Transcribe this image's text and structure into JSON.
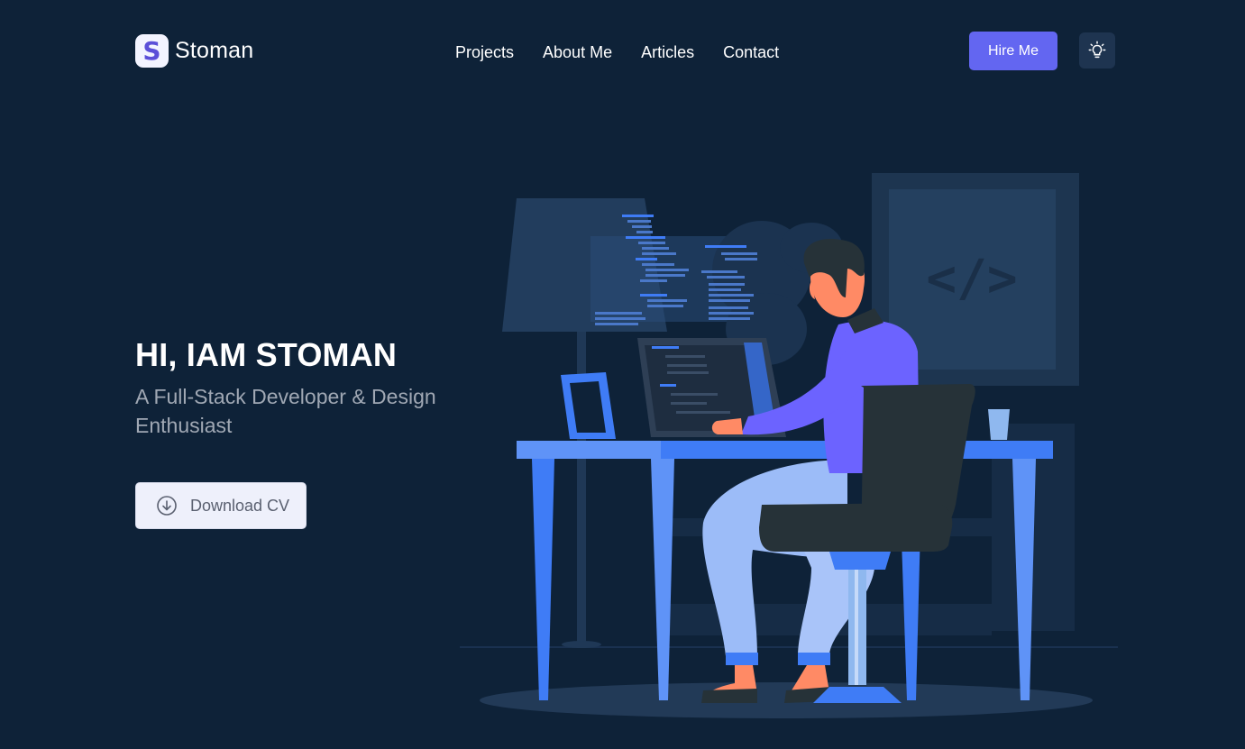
{
  "brand": {
    "logo_letter": "S",
    "name": "Stoman"
  },
  "nav": {
    "items": [
      {
        "label": "Projects"
      },
      {
        "label": "About Me"
      },
      {
        "label": "Articles"
      },
      {
        "label": "Contact"
      }
    ]
  },
  "header": {
    "hire_label": "Hire Me",
    "theme_icon": "lightbulb-icon"
  },
  "hero": {
    "title": "HI, IAM STOMAN",
    "subtitle": "A Full-Stack Developer & Design Enthusiast",
    "cv_label": "Download CV",
    "cv_icon": "download-icon"
  },
  "illustration": {
    "code_sign": "</>"
  },
  "colors": {
    "background": "#0e2238",
    "accent": "#6366f1",
    "desk_blue": "#3f7cf6",
    "shirt_purple": "#6c63ff"
  }
}
